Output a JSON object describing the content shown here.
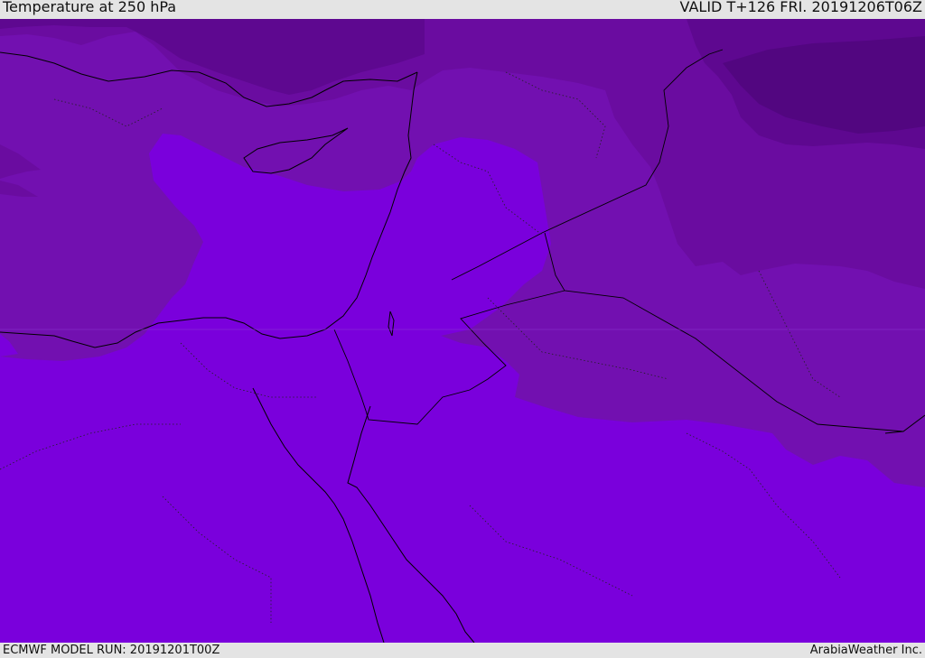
{
  "header": {
    "title": "Temperature at 250 hPa",
    "valid": "VALID T+126 FRI. 20191206T06Z"
  },
  "footer": {
    "model_run": "ECMWF MODEL RUN: 20191201T00Z",
    "credit": "ArabiaWeather Inc."
  },
  "colors": {
    "band_lightest": "#7a00dc",
    "band_light": "#7210b0",
    "band_mid": "#6a0ca0",
    "band_dark": "#5e0890",
    "band_darkest": "#520680",
    "lines": "#000000"
  }
}
